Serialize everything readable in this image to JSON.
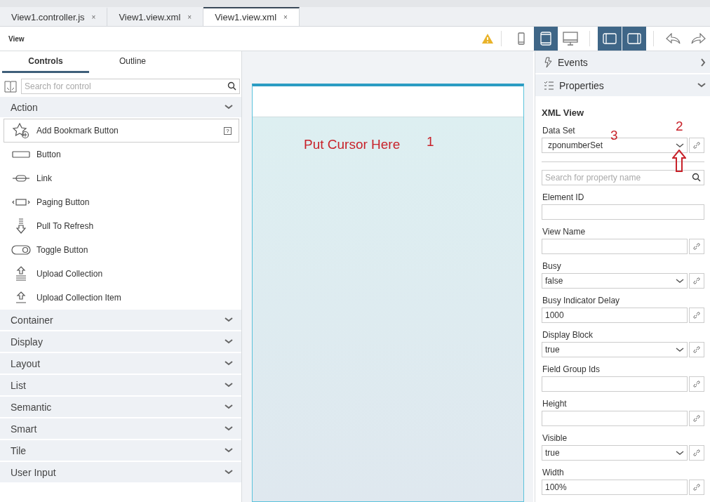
{
  "editor_tabs": [
    {
      "label": "View1.controller.js",
      "close": "×",
      "selected": false
    },
    {
      "label": "View1.view.xml",
      "close": "×",
      "selected": false
    },
    {
      "label": "View1.view.xml",
      "close": "×",
      "selected": true
    }
  ],
  "toolbar": {
    "title": "View",
    "devices": [
      {
        "kind": "phone",
        "selected": false
      },
      {
        "kind": "tablet",
        "selected": true
      },
      {
        "kind": "desktop",
        "selected": false
      }
    ],
    "panes": [
      {
        "kind": "left",
        "selected": true
      },
      {
        "kind": "right",
        "selected": true
      }
    ]
  },
  "left_panel": {
    "tabs": [
      {
        "label": "Controls",
        "selected": true
      },
      {
        "label": "Outline",
        "selected": false
      }
    ],
    "search": {
      "placeholder": "Search for control"
    },
    "categories": [
      {
        "label": "Action",
        "items": [
          {
            "label": "Add Bookmark Button",
            "kind": "bookmark",
            "selected": true,
            "help": "?"
          },
          {
            "label": "Button",
            "kind": "button",
            "selected": false
          },
          {
            "label": "Link",
            "kind": "link",
            "selected": false
          },
          {
            "label": "Paging Button",
            "kind": "paging",
            "selected": false
          },
          {
            "label": "Pull To Refresh",
            "kind": "refresh",
            "selected": false
          },
          {
            "label": "Toggle Button",
            "kind": "toggle",
            "selected": false
          },
          {
            "label": "Upload Collection",
            "kind": "upload_collection",
            "selected": false
          },
          {
            "label": "Upload Collection Item",
            "kind": "upload_item",
            "selected": false
          }
        ]
      },
      {
        "label": "Container"
      },
      {
        "label": "Display"
      },
      {
        "label": "Layout"
      },
      {
        "label": "List"
      },
      {
        "label": "Semantic"
      },
      {
        "label": "Smart"
      },
      {
        "label": "Tile"
      },
      {
        "label": "User Input"
      }
    ]
  },
  "canvas": {
    "annotation": "Put Cursor Here",
    "marker": "1"
  },
  "right_panel": {
    "sections": [
      {
        "label": "Events",
        "kind": "events",
        "expanded": false
      },
      {
        "label": "Properties",
        "kind": "properties",
        "expanded": true
      }
    ],
    "title": "XML View",
    "data_set": {
      "label": "Data Set",
      "value": "zponumberSet",
      "marker_number": "3",
      "marker_arrow": "2"
    },
    "search": {
      "placeholder": "Search for property name"
    },
    "properties": [
      {
        "label": "Element ID",
        "kind": "text",
        "link": false
      },
      {
        "label": "View Name",
        "kind": "text",
        "link": true
      },
      {
        "label": "Busy",
        "kind": "select",
        "value": "false",
        "link": true
      },
      {
        "label": "Busy Indicator Delay",
        "kind": "text",
        "value": "1000",
        "link": true
      },
      {
        "label": "Display Block",
        "kind": "select",
        "value": "true",
        "link": true
      },
      {
        "label": "Field Group Ids",
        "kind": "text",
        "link": true
      },
      {
        "label": "Height",
        "kind": "text",
        "link": true
      },
      {
        "label": "Visible",
        "kind": "select",
        "value": "true",
        "link": true
      },
      {
        "label": "Width",
        "kind": "text",
        "value": "100%",
        "link": true
      }
    ]
  }
}
